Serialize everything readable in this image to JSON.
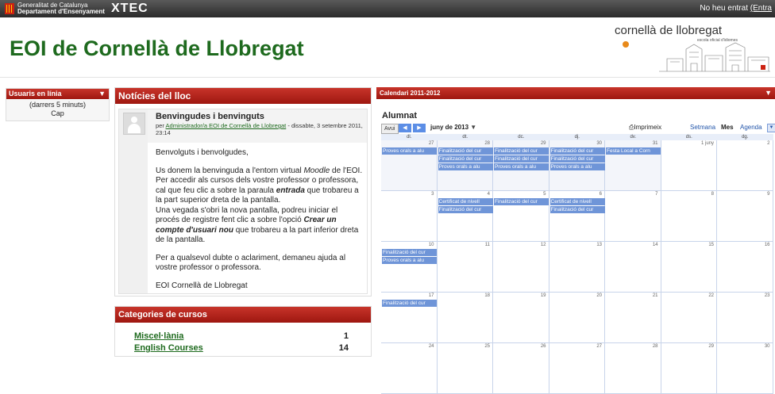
{
  "topbar": {
    "gov_line1": "Generalitat de Catalunya",
    "gov_line2": "Departament d'Ensenyament",
    "brand": "XTEC",
    "login_text": "No heu entrat",
    "login_link": "(Entra"
  },
  "site": {
    "title": "EOI de Cornellà de Llobregat",
    "logo_name": "cornellà de llobregat",
    "logo_sub": "escola oficial d'idiomes"
  },
  "online_users": {
    "title": "Usuaris en línia",
    "period": "(darrers 5 minuts)",
    "empty": "Cap"
  },
  "news": {
    "title": "Notícies del lloc",
    "post": {
      "subject": "Benvingudes i benvinguts",
      "by_prefix": "per",
      "author": "Administrador/a EOI de Cornellà de Llobregat",
      "date": "- dissabte, 3 setembre 2011, 23:14",
      "p1": "Benvolguts i benvolgudes,",
      "p2_a": "Us donem la benvinguda a l'entorn virtual ",
      "p2_em": "Moodle",
      "p2_b": " de l'EOI.",
      "p2_c": "Per accedir als cursos dels vostre professor o professora, cal que feu clic a sobre la paraula ",
      "p2_strong": "entrada",
      "p2_d": " que trobareu a la part superior dreta de la pantalla.",
      "p2_e": "Una vegada s'obri la nova pantalla, podreu iniciar el procés de registre fent clic a sobre l'opció ",
      "p2_strong2": "Crear un compte d'usuari nou",
      "p2_f": " que trobareu a la part inferior dreta de la pantalla.",
      "p3": "Per a qualsevol dubte o aclariment, demaneu ajuda al vostre professor o professora.",
      "p4": "EOI Cornellà de Llobregat"
    }
  },
  "categories": {
    "title": "Categories de cursos",
    "items": [
      {
        "name": "Miscel·lània",
        "count": "1"
      },
      {
        "name": "English Courses",
        "count": "14"
      }
    ]
  },
  "calendar": {
    "header": "Calendari 2011-2012",
    "title": "Alumnat",
    "today": "Avui",
    "month": "juny de 2013",
    "month_caret": "▼",
    "print": "Imprimeix",
    "views": [
      "Setmana",
      "Mes",
      "Agenda"
    ],
    "dow": [
      "dl.",
      "dt.",
      "dc.",
      "dj.",
      "dv.",
      "ds.",
      "dg."
    ],
    "weeks": [
      {
        "days": [
          "27",
          "28",
          "29",
          "30",
          "31",
          "1 juny",
          "2"
        ],
        "muted": [
          true,
          true,
          true,
          true,
          true,
          false,
          false
        ],
        "events": [
          [
            "Proves orals a alu",
            "Finalització del cur",
            "Finalització del cur",
            "Finalització del cur",
            "Festa Local a Corn",
            "",
            ""
          ],
          [
            "",
            "Finalització del cur",
            "Finalització del cur",
            "Finalització del cur",
            "",
            "",
            ""
          ],
          [
            "",
            "Proves orals a alu",
            "Proves orals a alu",
            "Proves orals a alu",
            "",
            "",
            ""
          ]
        ]
      },
      {
        "days": [
          "3",
          "4",
          "5",
          "6",
          "7",
          "8",
          "9"
        ],
        "muted": [
          false,
          false,
          false,
          false,
          false,
          false,
          false
        ],
        "events": [
          [
            "",
            "Certificat de nivell",
            "Finalització del cur",
            "Certificat de nivell",
            "",
            "",
            ""
          ],
          [
            "",
            "Finalització del cur",
            "",
            "Finalització del cur",
            "",
            "",
            ""
          ]
        ]
      },
      {
        "days": [
          "10",
          "11",
          "12",
          "13",
          "14",
          "15",
          "16"
        ],
        "muted": [
          false,
          false,
          false,
          false,
          false,
          false,
          false
        ],
        "events": [
          [
            "Finalització del cur",
            "",
            "",
            "",
            "",
            "",
            ""
          ],
          [
            "Proves orals a alu",
            "",
            "",
            "",
            "",
            "",
            ""
          ]
        ]
      },
      {
        "days": [
          "17",
          "18",
          "19",
          "20",
          "21",
          "22",
          "23"
        ],
        "muted": [
          false,
          false,
          false,
          false,
          false,
          false,
          false
        ],
        "events": [
          [
            "Finalització del cur",
            "",
            "",
            "",
            "",
            "",
            ""
          ]
        ]
      },
      {
        "days": [
          "24",
          "25",
          "26",
          "27",
          "28",
          "29",
          "30"
        ],
        "muted": [
          false,
          false,
          false,
          false,
          false,
          false,
          false
        ],
        "events": []
      }
    ]
  }
}
